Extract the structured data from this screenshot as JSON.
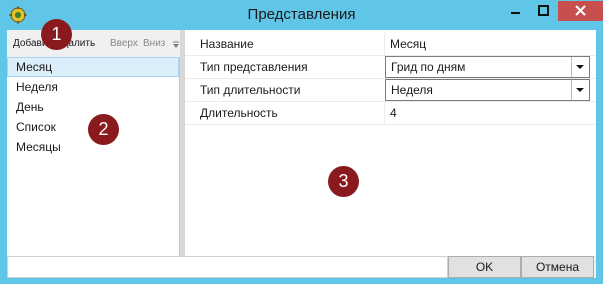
{
  "window": {
    "title": "Представления",
    "icon": "gear-icon",
    "controls": [
      "minimize-icon",
      "maximize-icon",
      "close-icon"
    ]
  },
  "toolbar": {
    "add_label": "Добави",
    "delete_label": "Удалить",
    "up_label": "Вверх",
    "down_label": "Вниз"
  },
  "views_list": {
    "items": [
      "Месяц",
      "Неделя",
      "День",
      "Список",
      "Месяцы"
    ],
    "selected": "Месяц"
  },
  "properties": {
    "rows": [
      {
        "name": "Название",
        "value": "Месяц",
        "editor": "text"
      },
      {
        "name": "Тип представления",
        "value": "Грид по дням",
        "editor": "dropdown"
      },
      {
        "name": "Тип длительности",
        "value": "Неделя",
        "editor": "dropdown"
      },
      {
        "name": "Длительность",
        "value": "4",
        "editor": "text"
      }
    ]
  },
  "buttons": {
    "ok_label": "OK",
    "cancel_label": "Отмена"
  },
  "callouts": [
    "1",
    "2",
    "3"
  ],
  "colors": {
    "window_frame": "#5fc6e8",
    "close_button": "#c7504e",
    "selection": "#ddeefb",
    "callout": "#8b1a1f"
  }
}
